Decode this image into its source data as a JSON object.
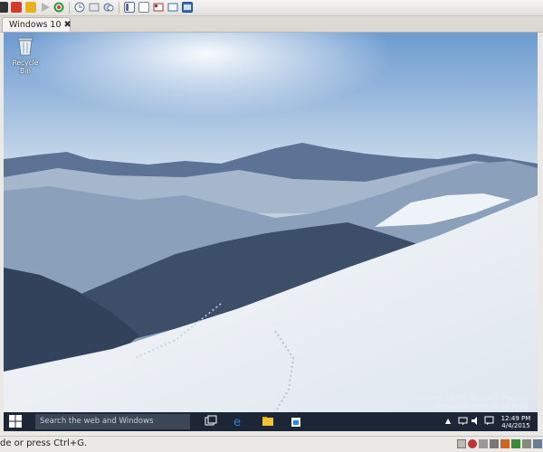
{
  "tab": {
    "label": "Windows 10"
  },
  "desktop": {
    "recycle_bin_label": "Recycle Bin",
    "watermark_line1": "Windows 10 Pro Technical Preview",
    "watermark_line2": "Evaluation copy. Build 9926"
  },
  "taskbar": {
    "search_placeholder": "Search the web and Windows",
    "time": "12:49 PM",
    "date": "4/4/2015"
  },
  "statusbar": {
    "hint_text": "de or press Ctrl+G."
  },
  "colors": {
    "taskbar": "#1c2636",
    "accent": "#2b88d8"
  }
}
